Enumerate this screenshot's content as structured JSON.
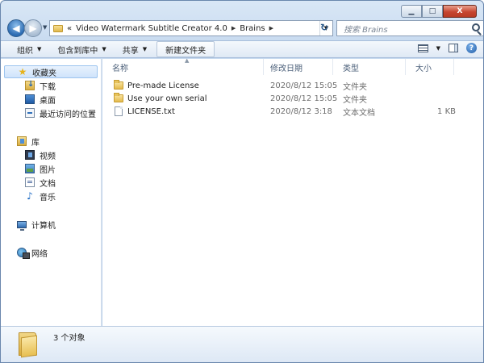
{
  "window": {
    "caption": {
      "minimize": "▁",
      "maximize": "□",
      "close": "X"
    }
  },
  "address": {
    "overflow": "«",
    "crumbs": [
      "Video Watermark Subtitle Creator 4.0",
      "Brains"
    ],
    "refresh_glyph": "↻",
    "search_placeholder": "搜索 Brains"
  },
  "toolbar": {
    "organize": "组织",
    "include_library": "包含到库中",
    "share": "共享",
    "new_folder": "新建文件夹"
  },
  "sidebar": {
    "favorites": {
      "label": "收藏夹",
      "items": [
        "下载",
        "桌面",
        "最近访问的位置"
      ]
    },
    "libraries": {
      "label": "库",
      "items": [
        "视频",
        "图片",
        "文档",
        "音乐"
      ]
    },
    "computer": "计算机",
    "network": "网络"
  },
  "columns": {
    "name": "名称",
    "date": "修改日期",
    "type": "类型",
    "size": "大小"
  },
  "files": [
    {
      "name": "Pre-made License",
      "date": "2020/8/12 15:05",
      "type": "文件夹",
      "size": "",
      "kind": "folder"
    },
    {
      "name": "Use your own serial",
      "date": "2020/8/12 15:05",
      "type": "文件夹",
      "size": "",
      "kind": "folder"
    },
    {
      "name": "LICENSE.txt",
      "date": "2020/8/12 3:18",
      "type": "文本文档",
      "size": "1 KB",
      "kind": "file"
    }
  ],
  "details": {
    "count": "3 个对象"
  }
}
